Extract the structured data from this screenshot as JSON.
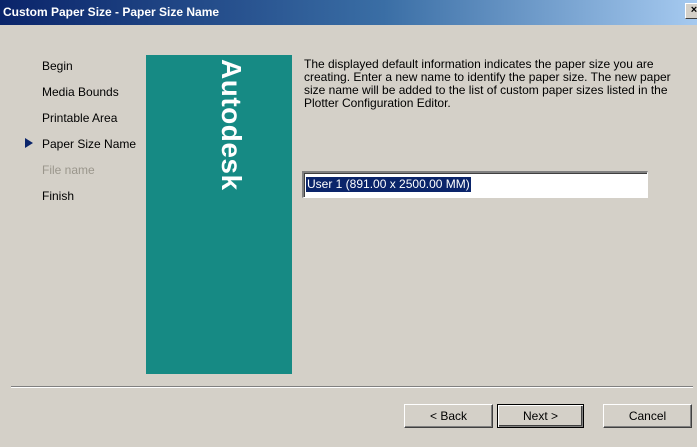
{
  "window": {
    "title": "Custom Paper Size - Paper Size Name",
    "close_label": "×"
  },
  "steps": [
    {
      "label": "Begin",
      "state": "normal"
    },
    {
      "label": "Media Bounds",
      "state": "normal"
    },
    {
      "label": "Printable Area",
      "state": "normal"
    },
    {
      "label": "Paper Size Name",
      "state": "current"
    },
    {
      "label": "File name",
      "state": "disabled"
    },
    {
      "label": "Finish",
      "state": "normal"
    }
  ],
  "banner": {
    "brand": "Autodesk",
    "color": "#168a84"
  },
  "content": {
    "description": "The displayed default information indicates the paper size you are creating. Enter a new name to identify the paper size. The new paper size name will be added to the list of custom paper sizes listed in the Plotter Configuration Editor.",
    "name_value": "User 1 (891.00 x 2500.00 MM)"
  },
  "buttons": {
    "back": "< Back",
    "next": "Next >",
    "cancel": "Cancel"
  },
  "icons": {
    "current_step_marker": "right-triangle-icon"
  }
}
